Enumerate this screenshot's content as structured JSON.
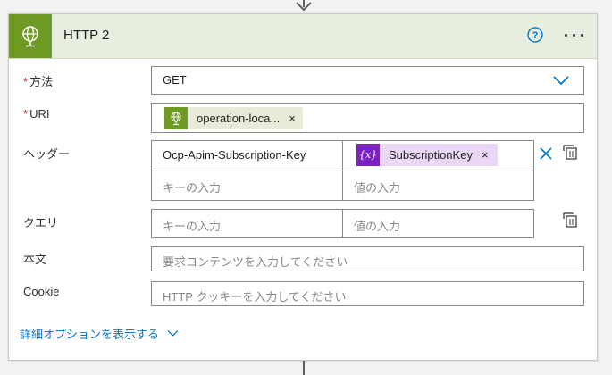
{
  "card": {
    "title": "HTTP 2",
    "icons": {
      "action": "globe-icon",
      "help": "help-circle-icon",
      "more": "more-dots-icon"
    }
  },
  "fields": {
    "method": {
      "label": "方法",
      "value": "GET",
      "required": true
    },
    "uri": {
      "label": "URI",
      "required": true,
      "token": {
        "text": "operation-loca...",
        "icon": "globe-icon",
        "remove": "×"
      }
    },
    "headers": {
      "label": "ヘッダー",
      "row1": {
        "key": "Ocp-Apim-Subscription-Key",
        "token": {
          "icon_text": "{x}",
          "text": "SubscriptionKey",
          "remove": "×"
        }
      },
      "row2": {
        "key_placeholder": "キーの入力",
        "value_placeholder": "値の入力"
      }
    },
    "queries": {
      "label": "クエリ",
      "key_placeholder": "キーの入力",
      "value_placeholder": "値の入力"
    },
    "body": {
      "label": "本文",
      "placeholder": "要求コンテンツを入力してください"
    },
    "cookie": {
      "label": "Cookie",
      "placeholder": "HTTP クッキーを入力してください"
    }
  },
  "advanced_link": "詳細オプションを表示する",
  "required_mark": "*",
  "colors": {
    "accent": "#0078d4",
    "action_green": "#6f9a24",
    "variable_purple": "#7c23bf",
    "required_red": "#a4262c"
  }
}
